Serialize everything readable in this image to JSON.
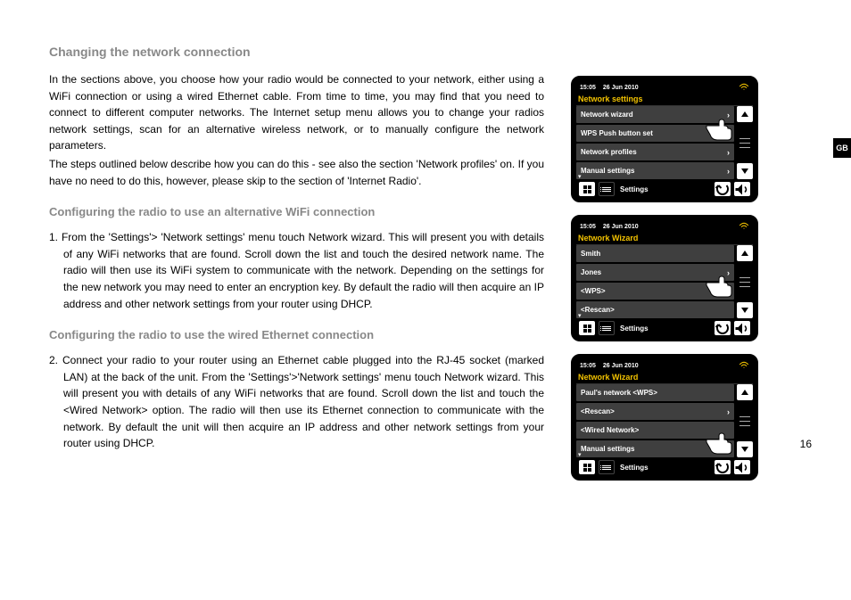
{
  "page_number": "16",
  "side_tab": "GB",
  "headings": {
    "h1": "Changing the network connection",
    "h2": "Configuring the radio to use an alternative WiFi connection",
    "h3": "Configuring the radio to use the wired Ethernet connection"
  },
  "paragraphs": {
    "intro1": "In the sections above, you choose how your radio would be connected to your network, either using a WiFi connection or using a wired Ethernet cable. From time to time, you may find that you need to connect to different computer networks. The Internet setup menu allows you to change your radios network settings, scan for an alternative wireless network, or to manually configure the network parameters.",
    "intro2": "The steps outlined below describe how you can do this - see also the section 'Network profiles' on. If you have no need to do this, however, please skip to the section of 'Internet Radio'.",
    "step1": "1. From the 'Settings'> 'Network settings' menu touch Network wizard. This will present you with details of any WiFi networks that are found. Scroll down the list and touch the desired network name. The radio will then use its WiFi system to communicate with the network. Depending on the settings for the new network you may need to enter an encryption key. By default the radio will then acquire an IP address and other network settings from your router using DHCP.",
    "step2": "2. Connect your radio to your router using an Ethernet cable plugged into the RJ-45 socket (marked LAN) at the back of the unit. From the 'Settings'>'Network settings' menu touch Network wizard. This will present you with details of any WiFi networks that are found. Scroll down the list and touch the <Wired Network> option. The radio will then use its Ethernet connection to communicate with the network. By default the unit will then acquire an IP address and other network settings from your router using DHCP."
  },
  "device": {
    "time": "15:05",
    "date": "26 Jun 2010",
    "footer_label": "Settings"
  },
  "screen1": {
    "title": "Network settings",
    "items": [
      "Network wizard",
      "WPS Push button set",
      "Network profiles",
      "Manual settings"
    ]
  },
  "screen2": {
    "title": "Network Wizard",
    "items": [
      "Smith",
      "Jones",
      "<WPS>",
      "<Rescan>"
    ]
  },
  "screen3": {
    "title": "Network Wizard",
    "items": [
      "Paul's network <WPS>",
      "<Rescan>",
      "<Wired Network>",
      "Manual settings"
    ]
  }
}
